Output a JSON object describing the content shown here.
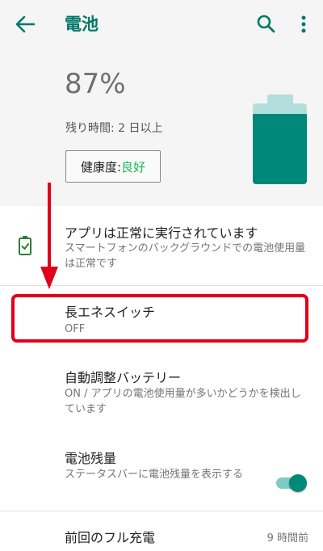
{
  "appbar": {
    "title": "電池",
    "back_icon": "arrow-left-icon",
    "search_icon": "search-icon",
    "more_icon": "more-vert-icon"
  },
  "header": {
    "percent": "87%",
    "battery_level": 0.87,
    "remaining": "残り時間: 2 日以上",
    "health_label": "健康度: ",
    "health_value": "良好"
  },
  "list": {
    "status": {
      "title": "アプリは正常に実行されています",
      "subtitle": "スマートフォンのバックグラウンドでの電池使用量は正常です",
      "icon": "battery-check-icon"
    },
    "saver": {
      "title": "長エネスイッチ",
      "subtitle": "OFF"
    },
    "adaptive": {
      "title": "自動調整バッテリー",
      "subtitle": "ON / アプリの電池使用量が多いかどうかを検出しています"
    },
    "percentage": {
      "title": "電池残量",
      "subtitle": "ステータスバーに電池残量を表示する",
      "toggle_on": true
    },
    "last_charge": {
      "title": "前回のフル充電",
      "value": "9 時間前"
    }
  },
  "colors": {
    "accent": "#00796b",
    "battery_fill": "#00897b",
    "battery_empty": "#b2dfdb",
    "health_good": "#1db954",
    "annotation": "#e0001a"
  }
}
